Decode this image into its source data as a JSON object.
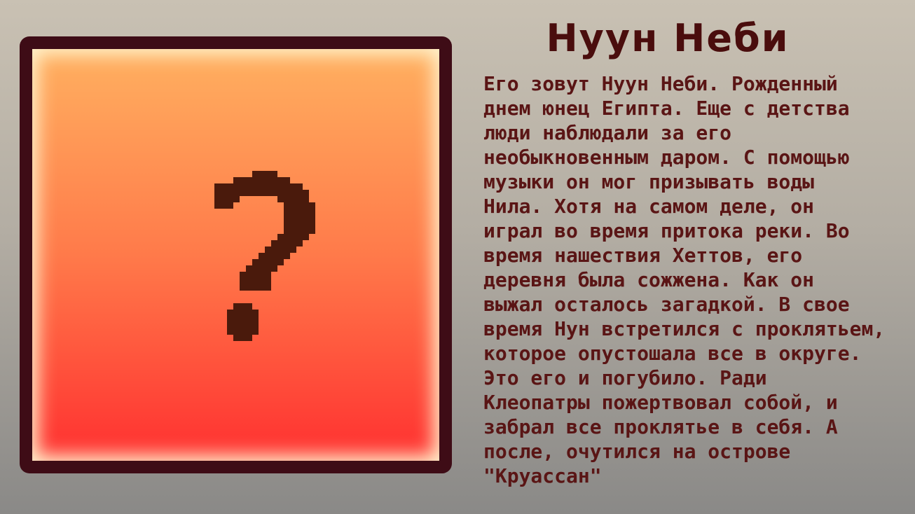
{
  "card": {
    "title": "Нуун Неби",
    "portrait": {
      "placeholder_icon": "question-mark-icon",
      "frame_color": "#3e0c16",
      "gradient_top": "#ffb060",
      "gradient_bottom": "#ff3030",
      "glow_color": "#fff2cc",
      "icon_color": "#4a1a0c"
    },
    "title_color": "#4a0d0d",
    "text_color": "#5a1515",
    "bio_lines": [
      "Его зовут Нуун Неби. Рожденный",
      "днем юнец Египта. Еще с детства",
      "люди наблюдали за его",
      "необыкновенным даром. С помощью",
      "музыки он мог призывать воды",
      "Нила. Хотя на самом деле, он",
      "играл во время притока реки. Во",
      "время нашествия Хеттов, его",
      "деревня была сожжена. Как он",
      "выжал осталось загадкой. В свое",
      "время Нун встретился с проклятьем,",
      "которое опустошала все в округе.",
      "Это его и погубило. Ради",
      "Клеопатры пожертвовал собой, и",
      "забрал все проклятье в себя. А",
      "после, очутился на острове",
      "\"Круассан\""
    ]
  }
}
